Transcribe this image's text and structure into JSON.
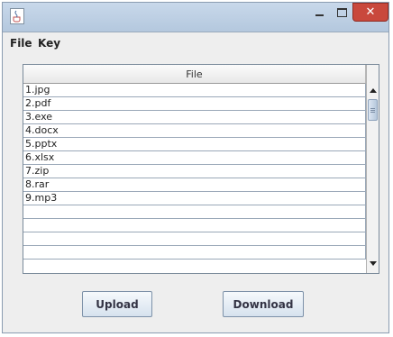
{
  "window": {
    "minimize_glyph": "",
    "close_glyph": "✕"
  },
  "menubar": {
    "items": [
      {
        "label": "File"
      },
      {
        "label": "Key"
      }
    ]
  },
  "table": {
    "column_header": "File",
    "rows": [
      "1.jpg",
      "2.pdf",
      "3.exe",
      "4.docx",
      "5.pptx",
      "6.xlsx",
      "7.zip",
      "8.rar",
      "9.mp3",
      "",
      "",
      "",
      ""
    ]
  },
  "buttons": {
    "upload_label": "Upload",
    "download_label": "Download"
  },
  "colors": {
    "close_button": "#c9483c",
    "titlebar": "#b4c8de",
    "grid_line": "#9aa8b8"
  }
}
